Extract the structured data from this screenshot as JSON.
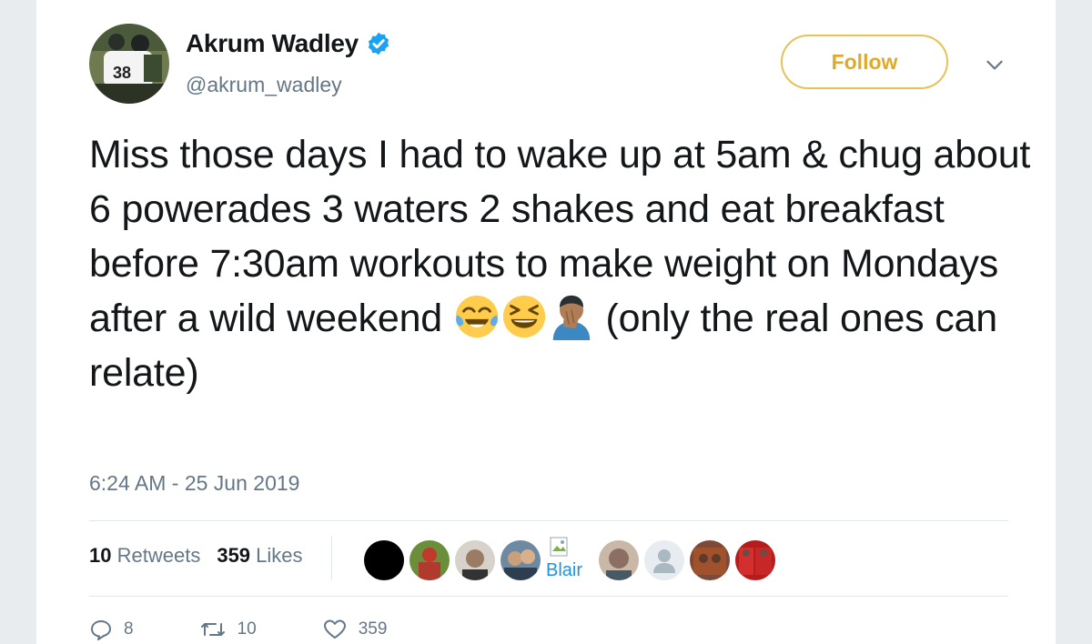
{
  "author": {
    "name": "Akrum Wadley",
    "handle": "@akrum_wadley",
    "avatar_icon": "football-player-avatar",
    "verified": true
  },
  "follow_button": {
    "label": "Follow"
  },
  "menu": {
    "icon": "chevron-down-icon"
  },
  "tweet": {
    "text_part1": "Miss those days I had to wake up at 5am & chug about 6 powerades 3 waters 2 shakes and eat breakfast before 7:30am workouts to make weight on Mondays after a wild weekend ",
    "emojis": [
      "face-with-tears-of-joy",
      "grinning-squinting-face",
      "person-facepalming"
    ],
    "text_part2": "(only the real ones can relate)",
    "timestamp": "6:24 AM - 25 Jun 2019"
  },
  "stats": {
    "retweets_count": "10",
    "retweets_label": "Retweets",
    "likes_count": "359",
    "likes_label": "Likes"
  },
  "likers": {
    "broken_image_alt": "Blair"
  },
  "actions": {
    "reply_count": "8",
    "retweet_count": "10",
    "like_count": "359"
  },
  "colors": {
    "follow_accent": "#e8c158",
    "verified_blue": "#1da1f2",
    "muted_text": "#657786"
  }
}
